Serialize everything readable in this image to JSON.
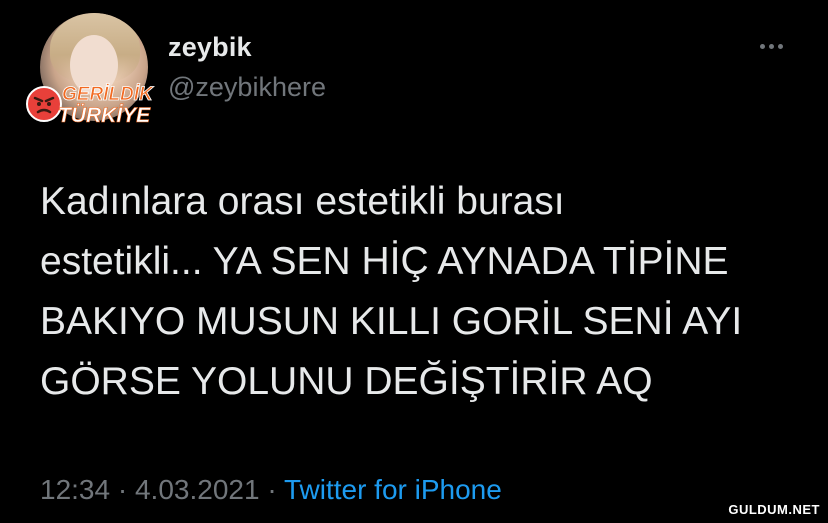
{
  "tweet": {
    "display_name": "zeybik",
    "handle": "@zeybikhere",
    "text": "Kadınlara orası estetikli burası\nestetikli... YA SEN HİÇ AYNADA TİPİNE\nBAKIYO MUSUN KILLI GORİL SENİ AYI\nGÖRSE YOLUNU DEĞİŞTİRİR AQ",
    "time": "12:34",
    "separator_1": " · ",
    "date": "4.03.2021",
    "separator_2": " · ",
    "source": "Twitter for iPhone",
    "more_icon": "more-horizontal-icon"
  },
  "overlay": {
    "logo_line1": "GERİLDİK",
    "logo_line2": "TÜRKİYE",
    "site_watermark": "GULDUM.NET"
  },
  "colors": {
    "background": "#000000",
    "primary_text": "#e7e9ea",
    "secondary_text": "#71767b",
    "link": "#1d9bf0",
    "logo_orange": "#f26a21",
    "logo_emoji": "#e8403a"
  }
}
